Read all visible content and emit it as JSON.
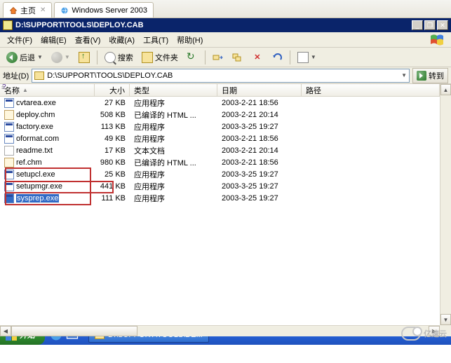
{
  "tabs": [
    {
      "label": "主页",
      "icon": "home"
    },
    {
      "label": "Windows Server 2003",
      "icon": "ie"
    }
  ],
  "titlebar": {
    "text": "D:\\SUPPORT\\TOOLS\\DEPLOY.CAB"
  },
  "menubar": {
    "file": "文件(F)",
    "edit": "编辑(E)",
    "view": "查看(V)",
    "favorites": "收藏(A)",
    "tools": "工具(T)",
    "help": "帮助(H)"
  },
  "toolbar": {
    "back": "后退",
    "search": "搜索",
    "folders": "文件夹"
  },
  "addressbar": {
    "label": "地址(D)",
    "value": "D:\\SUPPORT\\TOOLS\\DEPLOY.CAB",
    "go": "转到"
  },
  "columns": {
    "name": "名称",
    "size": "大小",
    "type": "类型",
    "date": "日期",
    "path": "路径"
  },
  "types": {
    "exe": "应用程序",
    "chm": "已编译的 HTML ...",
    "txt": "文本文档"
  },
  "files": [
    {
      "name": "cvtarea.exe",
      "size": "27 KB",
      "type": "exe",
      "date": "2003-2-21 18:56",
      "sel": false,
      "hl": false
    },
    {
      "name": "deploy.chm",
      "size": "508 KB",
      "type": "chm",
      "date": "2003-2-21 20:14",
      "sel": false,
      "hl": false
    },
    {
      "name": "factory.exe",
      "size": "113 KB",
      "type": "exe",
      "date": "2003-3-25 19:27",
      "sel": false,
      "hl": false
    },
    {
      "name": "oformat.com",
      "size": "49 KB",
      "type": "exe",
      "date": "2003-2-21 18:56",
      "sel": false,
      "hl": false
    },
    {
      "name": "readme.txt",
      "size": "17 KB",
      "type": "txt",
      "date": "2003-2-21 20:14",
      "sel": false,
      "hl": false
    },
    {
      "name": "ref.chm",
      "size": "980 KB",
      "type": "chm",
      "date": "2003-2-21 18:56",
      "sel": false,
      "hl": false
    },
    {
      "name": "setupcl.exe",
      "size": "25 KB",
      "type": "exe",
      "date": "2003-3-25 19:27",
      "sel": false,
      "hl": true
    },
    {
      "name": "setupmgr.exe",
      "size": "441 KB",
      "type": "exe",
      "date": "2003-3-25 19:27",
      "sel": false,
      "hl": true
    },
    {
      "name": "sysprep.exe",
      "size": "111 KB",
      "type": "exe",
      "date": "2003-3-25 19:27",
      "sel": true,
      "hl": true
    }
  ],
  "taskbar": {
    "start": "开始",
    "task1": "D:\\SUPPORT\\TOOLS\\DE..."
  },
  "watermark": "亿速云"
}
